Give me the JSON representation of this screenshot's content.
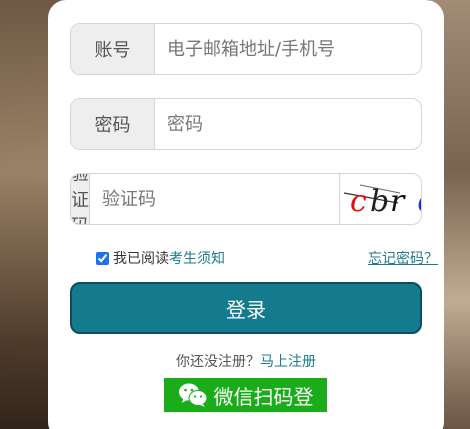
{
  "form": {
    "account": {
      "label": "账号",
      "placeholder": "电子邮箱地址/手机号",
      "value": ""
    },
    "password": {
      "label": "密码",
      "placeholder": "密码",
      "value": ""
    },
    "captcha": {
      "label": "验证码",
      "placeholder": "验证码",
      "value": "",
      "image_text": [
        "c",
        "b",
        "r",
        " ",
        "d"
      ]
    },
    "agree": {
      "checked": true,
      "prefix": "我已阅读",
      "link": "考生须知"
    },
    "forgot_link": "忘记密码？",
    "login_label": "登录",
    "register_prompt": "你还没注册？",
    "register_link": "马上注册",
    "wechat_label": "微信扫码登"
  },
  "colors": {
    "accent": "#147a8e",
    "link": "#1e7a8c",
    "wechat": "#1aad19"
  }
}
